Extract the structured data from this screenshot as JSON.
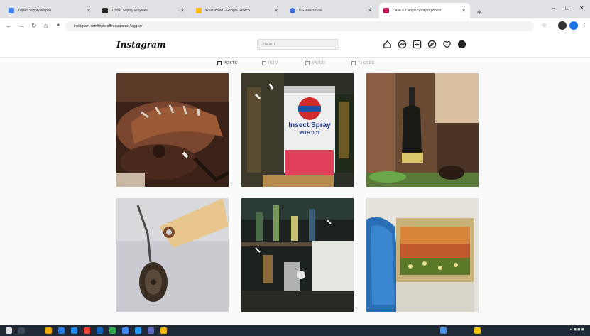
{
  "browser": {
    "tabs": [
      {
        "title": "Tripler Supply Aleppo",
        "color": "#4285f4"
      },
      {
        "title": "Tripler Supply Etsysale",
        "color": "#222222"
      },
      {
        "title": "Whatsmold - Google Search",
        "color": "#fbbc05"
      },
      {
        "title": "US Insecticide",
        "color": "#3b6fd8"
      },
      {
        "title": "Case & Carlyle Sprayer photos",
        "color": "#c2185b"
      }
    ],
    "new_tab": "+",
    "url": "instagram.com/tripleraffireoutparcel/tagged/",
    "window_controls": [
      "–",
      "□",
      "✕"
    ]
  },
  "header": {
    "logo": "Instagram",
    "search_placeholder": "Search",
    "icons": [
      "home-icon",
      "messenger-icon",
      "new-post-icon",
      "explore-icon",
      "heart-icon",
      "avatar"
    ]
  },
  "profile_tabs": [
    {
      "label": "POSTS",
      "active": true
    },
    {
      "label": "IGTV",
      "active": false
    },
    {
      "label": "SAVED",
      "active": false
    },
    {
      "label": "TAGGED",
      "active": false
    }
  ],
  "posts": [
    {
      "subject": "carved wooden object"
    },
    {
      "subject": "Insect Spray can"
    },
    {
      "subject": "dark bottle"
    },
    {
      "subject": "pulley with tag"
    },
    {
      "subject": "shelf of bottles"
    },
    {
      "subject": "painted tin box"
    }
  ],
  "post_texts": {
    "insect_spray": "Insect Spray",
    "with_ddt": "WITH DDT"
  }
}
